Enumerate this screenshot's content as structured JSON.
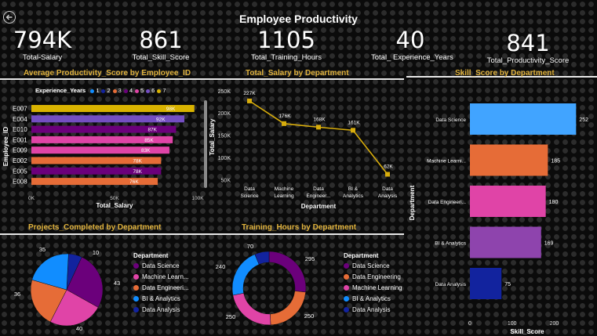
{
  "page": {
    "title": "Employee Productivity"
  },
  "kpis": [
    {
      "value": "794K",
      "label": "Total-Salary"
    },
    {
      "value": "861",
      "label": "Total_Skill_Score"
    },
    {
      "value": "1105",
      "label": "Total_Training_Hours"
    },
    {
      "value": "40",
      "label": "Total_ Experience_Years"
    },
    {
      "value": "841",
      "label": "Total_Productivity_Score"
    }
  ],
  "colors": {
    "gold": "#d8ad0c",
    "purple": "#8e44ad",
    "blue": "#118dff",
    "orange": "#e66c37",
    "pink": "#e044a7",
    "violet": "#744ec2",
    "darkblue": "#12239e",
    "deeppurple": "#6b007b",
    "skyblue": "#41a4ff"
  },
  "chart_data": [
    {
      "type": "bar",
      "orientation": "horizontal",
      "title": "Average Productivity_Score by Employee_ID",
      "xlabel": "Total_Salary",
      "ylabel": "Employee_ID",
      "legend_title": "Experience_Years",
      "legend": [
        "1",
        "2",
        "3",
        "4",
        "5",
        "6",
        "7"
      ],
      "legend_colors": [
        "#118dff",
        "#12239e",
        "#e66c37",
        "#6b007b",
        "#e044a7",
        "#744ec2",
        "#d9b300"
      ],
      "categories": [
        "E007",
        "E004",
        "E010",
        "E001",
        "E009",
        "E002",
        "E005",
        "E008"
      ],
      "values": [
        98,
        92,
        87,
        85,
        83,
        78,
        78,
        76
      ],
      "value_labels": [
        "98K",
        "92K",
        "87K",
        "85K",
        "83K",
        "78K",
        "78K",
        "76K"
      ],
      "bar_colors": [
        "#d9b300",
        "#744ec2",
        "#6b007b",
        "#e044a7",
        "#e044a7",
        "#e66c37",
        "#6b007b",
        "#e66c37"
      ],
      "xticks": [
        "0K",
        "50K",
        "100K"
      ],
      "xlim": [
        0,
        100
      ]
    },
    {
      "type": "line",
      "title": "Total_Salary by Department",
      "xlabel": "Department",
      "ylabel": "Total_Salary",
      "categories": [
        "Data\nScience",
        "Machine\nLearning",
        "Data\nEngineer...",
        "BI &\nAnalytics",
        "Data\nAnalysis"
      ],
      "values": [
        227,
        176,
        168,
        161,
        62
      ],
      "value_labels": [
        "227K",
        "176K",
        "168K",
        "161K",
        "62K"
      ],
      "yticks": [
        "50K",
        "100K",
        "150K",
        "200K",
        "250K"
      ],
      "ylim": [
        40,
        255
      ],
      "color": "#d8ad0c"
    },
    {
      "type": "bar",
      "orientation": "horizontal",
      "title": "Skill_Score by Department",
      "xlabel": "Skill_Score",
      "ylabel": "Department",
      "categories": [
        "Data Science",
        "Machine Learni...",
        "Data Engineeri...",
        "BI & Analytics",
        "Data Analysis"
      ],
      "values": [
        252,
        185,
        180,
        169,
        75
      ],
      "bar_colors": [
        "#41a4ff",
        "#e66c37",
        "#e044a7",
        "#8e44ad",
        "#12239e"
      ],
      "xticks": [
        "0",
        "100",
        "200"
      ],
      "xlim": [
        0,
        270
      ]
    },
    {
      "type": "pie",
      "title": "Projects_Completed by Department",
      "legend_title": "Department",
      "labels": [
        "Data Science",
        "Machine Learn...",
        "Data Engineeri...",
        "BI & Analytics",
        "Data Analysis"
      ],
      "values": [
        43,
        40,
        36,
        35,
        10
      ],
      "colors": [
        "#6b007b",
        "#e044a7",
        "#e66c37",
        "#118dff",
        "#12239e"
      ]
    },
    {
      "type": "pie",
      "donut": true,
      "title": "Training_Hours by Department",
      "legend_title": "Department",
      "labels": [
        "Data Science",
        "Data Engineering",
        "Machine Learning",
        "BI & Analytics",
        "Data Analysis"
      ],
      "values": [
        295,
        250,
        250,
        240,
        70
      ],
      "colors": [
        "#6b007b",
        "#e66c37",
        "#e044a7",
        "#118dff",
        "#12239e"
      ]
    }
  ]
}
